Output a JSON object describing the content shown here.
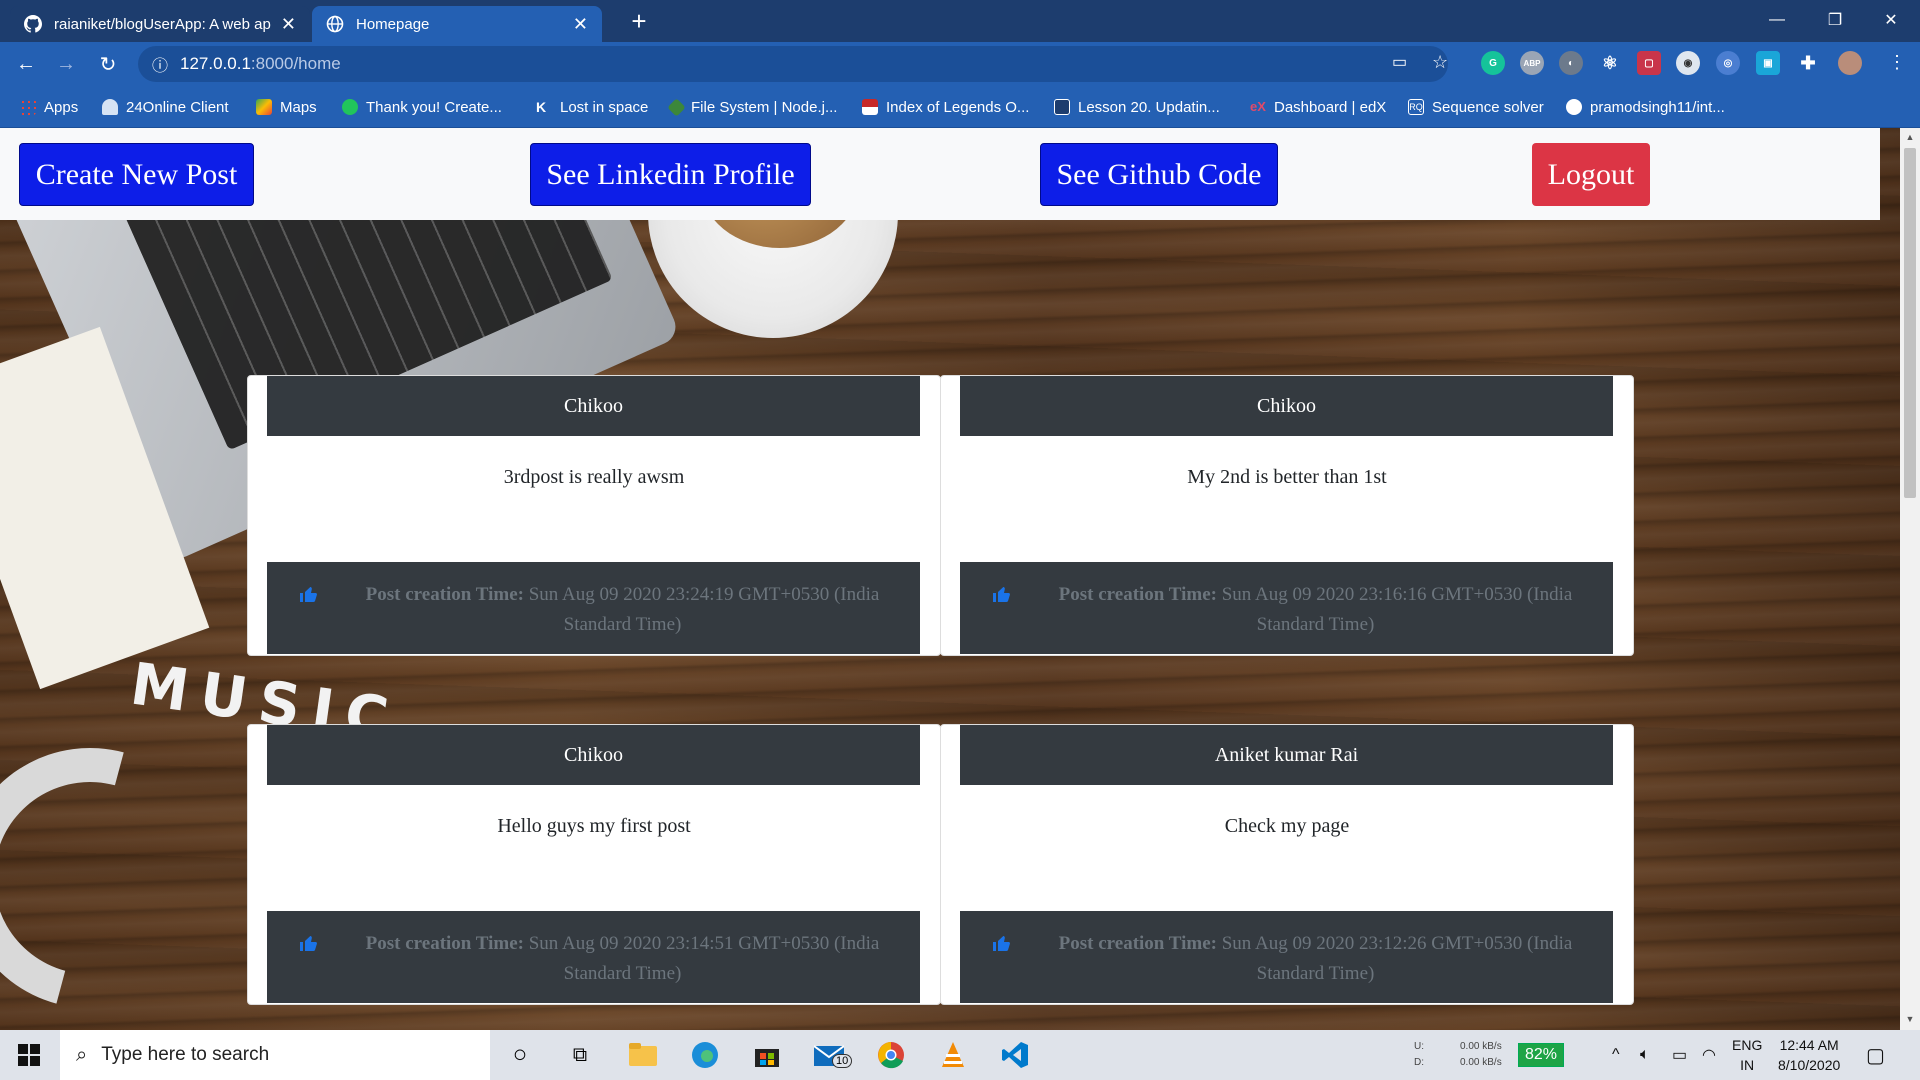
{
  "browser": {
    "tabs": [
      {
        "title": "raianiket/blogUserApp: A web ap",
        "active": false
      },
      {
        "title": "Homepage",
        "active": true
      }
    ],
    "url_host": "127.0.0.1",
    "url_path": ":8000/home",
    "bookmarks": [
      "Apps",
      "24Online Client",
      "Maps",
      "Thank you! Create...",
      "Lost in space",
      "File System | Node.j...",
      "Index of Legends O...",
      "Lesson 20. Updatin...",
      "Dashboard | edX",
      "Sequence solver",
      "pramodsingh11/int..."
    ]
  },
  "nav": {
    "create_label": "Create New Post",
    "linkedin_label": "See Linkedin Profile",
    "github_label": "See Github Code",
    "logout_label": "Logout"
  },
  "background_text": "MUSIC",
  "posts": [
    {
      "author": "Chikoo",
      "content": "3rdpost is really awsm",
      "time_label": "Post creation Time:",
      "time": "Sun Aug 09 2020 23:24:19 GMT+0530 (India Standard Time)"
    },
    {
      "author": "Chikoo",
      "content": "My 2nd is better than 1st",
      "time_label": "Post creation Time:",
      "time": "Sun Aug 09 2020 23:16:16 GMT+0530 (India Standard Time)"
    },
    {
      "author": "Chikoo",
      "content": "Hello guys my first post",
      "time_label": "Post creation Time:",
      "time": "Sun Aug 09 2020 23:14:51 GMT+0530 (India Standard Time)"
    },
    {
      "author": "Aniket kumar Rai",
      "content": "Check my page",
      "time_label": "Post creation Time:",
      "time": "Sun Aug 09 2020 23:12:26 GMT+0530 (India Standard Time)"
    }
  ],
  "taskbar": {
    "search_placeholder": "Type here to search",
    "mail_badge": "10",
    "net_up_label": "U:",
    "net_down_label": "D:",
    "net_up": "0.00 kB/s",
    "net_down": "0.00 kB/s",
    "battery": "82%",
    "lang_top": "ENG",
    "lang_bottom": "IN",
    "time": "12:44 AM",
    "date": "8/10/2020"
  },
  "colors": {
    "primary_button": "#0d1ee8",
    "danger_button": "#dc3545",
    "card_header": "#343a40",
    "chrome_tabbar": "#1d3d6e",
    "chrome_toolbar": "#2460b3",
    "like_icon": "#1a73e8"
  }
}
